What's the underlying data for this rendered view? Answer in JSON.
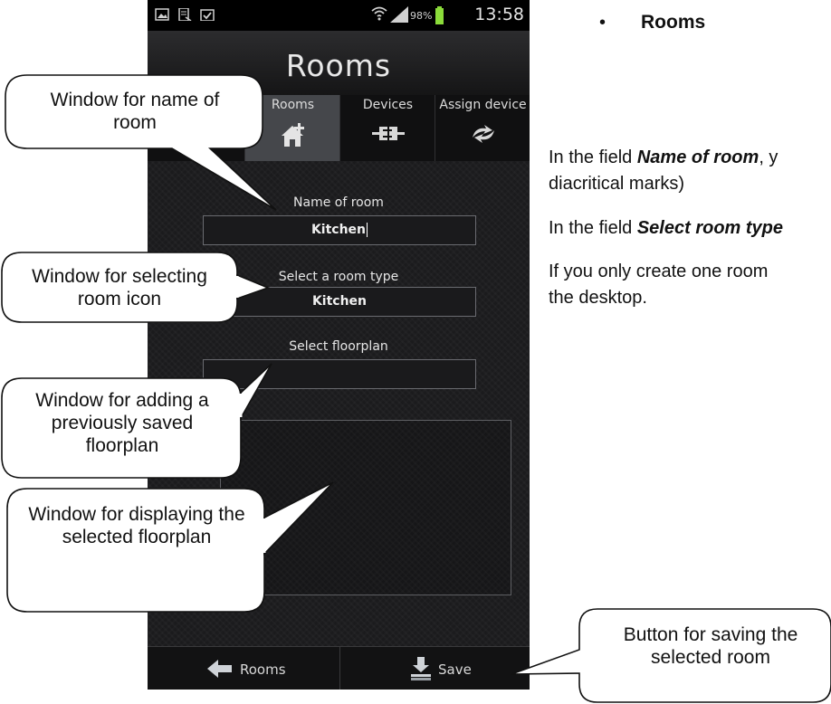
{
  "status_bar": {
    "battery_percent": "98%",
    "time": "13:58"
  },
  "app": {
    "title": "Rooms"
  },
  "tabs": [
    {
      "label": "",
      "icon": "blank"
    },
    {
      "label": "Rooms",
      "icon": "house-add-icon"
    },
    {
      "label": "Devices",
      "icon": "plug-icon"
    },
    {
      "label": "Assign device",
      "icon": "sync-arrows-icon"
    }
  ],
  "form": {
    "name_label": "Name of room",
    "name_value": "Kitchen",
    "type_label": "Select a room type",
    "type_value": "Kitchen",
    "floorplan_label": "Select floorplan",
    "floorplan_value": ""
  },
  "bottom_bar": {
    "back_label": "Rooms",
    "save_label": "Save"
  },
  "callouts": {
    "name": "Window for name of room",
    "type": "Window for selecting room icon",
    "add_floorplan": "Window for adding a previously saved floorplan",
    "display_floorplan": "Window for displaying the selected floorplan",
    "save": "Button for saving the selected room"
  },
  "doc": {
    "bullet": "•",
    "heading": "Rooms",
    "p1_prefix": "In the field ",
    "p1_bold": "Name of room",
    "p1_suffix": ", y",
    "p1_line2": "diacritical marks)",
    "p2_prefix": "In the field ",
    "p2_bold": "Select room type",
    "p3_line1": "If you only create one room",
    "p3_line2": "the desktop."
  },
  "colors": {
    "phone_background": "#1b1b1d",
    "active_tab": "#45474b",
    "field_border": "#6a6b70"
  }
}
